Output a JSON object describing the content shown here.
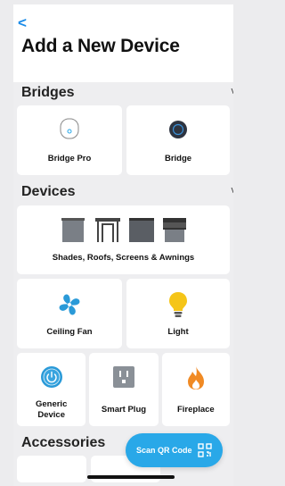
{
  "header": {
    "back_glyph": "<",
    "title": "Add a New Device"
  },
  "bridges": {
    "label": "Bridges",
    "chevron": "v",
    "items": [
      {
        "label": "Bridge Pro",
        "icon": "bridge-pro-icon"
      },
      {
        "label": "Bridge",
        "icon": "bridge-icon"
      }
    ]
  },
  "devices": {
    "label": "Devices",
    "chevron": "v",
    "shades": {
      "label": "Shades, Roofs, Screens & Awnings",
      "icon": "shades-icon"
    },
    "row2": [
      {
        "label": "Ceiling Fan",
        "icon": "ceiling-fan-icon"
      },
      {
        "label": "Light",
        "icon": "light-bulb-icon"
      }
    ],
    "row3": [
      {
        "label": "Generic Device",
        "icon": "power-icon"
      },
      {
        "label": "Smart Plug",
        "icon": "smart-plug-icon"
      },
      {
        "label": "Fireplace",
        "icon": "fireplace-icon"
      }
    ]
  },
  "accessories": {
    "label": "Accessories"
  },
  "scan": {
    "label": "Scan QR Code",
    "icon": "qr-code-icon"
  },
  "colors": {
    "accent": "#1b8be8",
    "scan_button": "#29a8e8",
    "fan_blue": "#2a9ad8",
    "bulb_yellow": "#f5c518",
    "fire_orange": "#f08a24"
  }
}
